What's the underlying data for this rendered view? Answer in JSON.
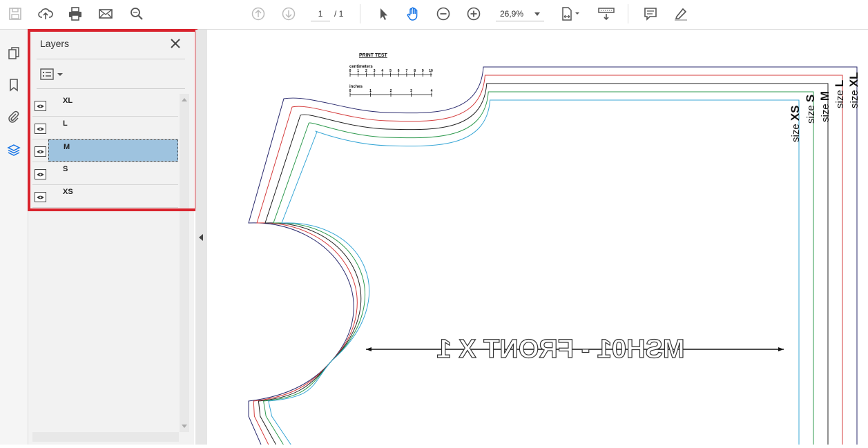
{
  "toolbar": {
    "icons": [
      "save-icon",
      "cloud-upload-icon",
      "print-icon",
      "email-icon",
      "search-icon",
      "page-up-icon",
      "page-down-icon",
      "select-cursor-icon",
      "hand-icon",
      "zoom-out-icon",
      "zoom-in-icon",
      "page-fit-icon",
      "scroll-mode-icon",
      "comment-icon",
      "highlight-icon"
    ],
    "page_current": "1",
    "page_total": "/ 1",
    "zoom": "26,9%"
  },
  "left_rail": {
    "icons": [
      "pages-icon",
      "bookmark-icon",
      "attachment-icon",
      "layers-icon"
    ]
  },
  "layers_panel": {
    "title": "Layers",
    "layers": [
      {
        "name": "XL",
        "selected": false
      },
      {
        "name": "L",
        "selected": false
      },
      {
        "name": "M",
        "selected": true
      },
      {
        "name": "S",
        "selected": false
      },
      {
        "name": "XS",
        "selected": false
      }
    ]
  },
  "document": {
    "print_test": {
      "title": "PRINT TEST",
      "centimeters_label": "centimeters",
      "cm_ticks": [
        "0",
        "1",
        "2",
        "3",
        "4",
        "5",
        "6",
        "7",
        "8",
        "9",
        "10"
      ],
      "inches_label": "inches",
      "inch_ticks": [
        "0",
        "1",
        "2",
        "3",
        "4"
      ]
    },
    "pattern_label": "MSH01 - FRONT X 1",
    "size_labels": [
      {
        "prefix": "size ",
        "size": "XS"
      },
      {
        "prefix": "size ",
        "size": "S"
      },
      {
        "prefix": "size ",
        "size": "M"
      },
      {
        "prefix": "size ",
        "size": "L"
      },
      {
        "prefix": "size ",
        "size": "XL"
      }
    ],
    "colors": {
      "XL": "#2a2a6e",
      "L": "#d43d3d",
      "M": "#222222",
      "S": "#2f9a4f",
      "XS": "#39a7d6"
    }
  }
}
